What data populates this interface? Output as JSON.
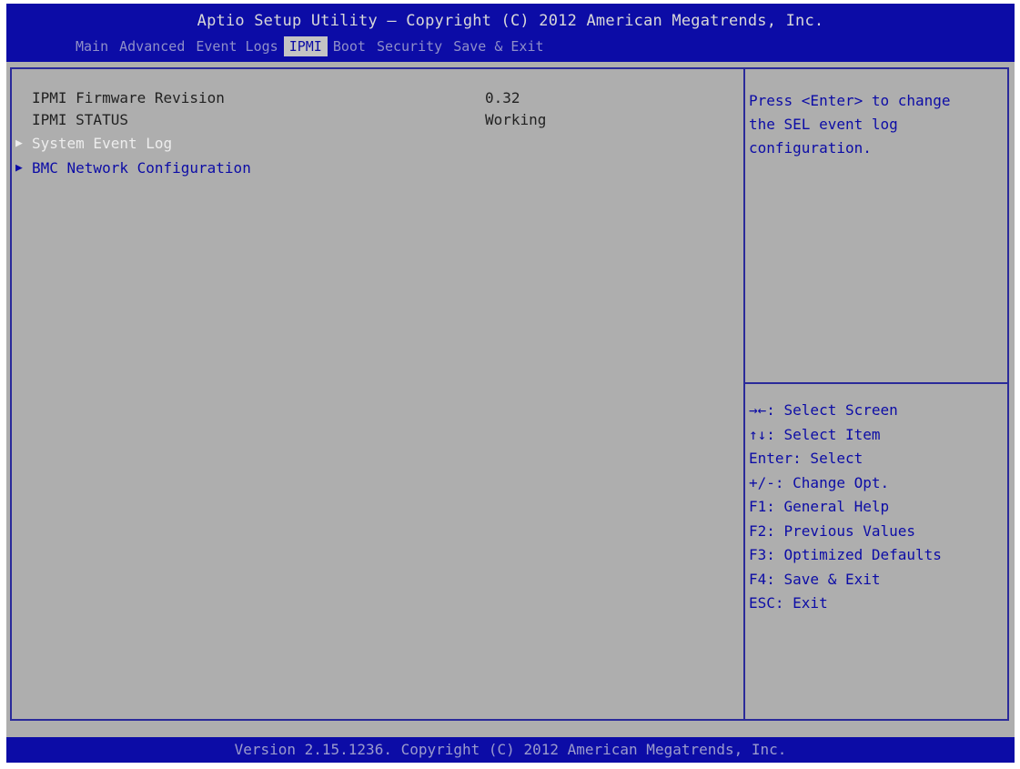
{
  "header": {
    "title": "Aptio Setup Utility – Copyright (C) 2012 American Megatrends, Inc.",
    "tabs": [
      {
        "label": "Main",
        "active": false
      },
      {
        "label": "Advanced",
        "active": false
      },
      {
        "label": "Event Logs",
        "active": false
      },
      {
        "label": "IPMI",
        "active": true
      },
      {
        "label": "Boot",
        "active": false
      },
      {
        "label": "Security",
        "active": false
      },
      {
        "label": "Save & Exit",
        "active": false
      }
    ]
  },
  "main": {
    "info_rows": [
      {
        "label": "IPMI Firmware Revision",
        "value": "0.32"
      },
      {
        "label": "IPMI STATUS",
        "value": "Working"
      }
    ],
    "submenus": [
      {
        "arrow": "▶",
        "label": "System Event Log",
        "selected": true
      },
      {
        "arrow": "▶",
        "label": "BMC Network Configuration",
        "selected": false
      }
    ]
  },
  "help": {
    "lines": [
      "Press <Enter> to change",
      "the SEL event log",
      "configuration."
    ]
  },
  "keys": [
    "→←: Select Screen",
    "↑↓: Select Item",
    "Enter: Select",
    "+/-: Change Opt.",
    "F1: General Help",
    "F2: Previous Values",
    "F3: Optimized Defaults",
    "F4: Save & Exit",
    "ESC: Exit"
  ],
  "footer": {
    "text": "Version 2.15.1236. Copyright (C) 2012 American Megatrends, Inc."
  },
  "colors": {
    "bar": "#0c0ca6",
    "background": "#aeaeae",
    "accent_text": "#0c0ca6"
  }
}
